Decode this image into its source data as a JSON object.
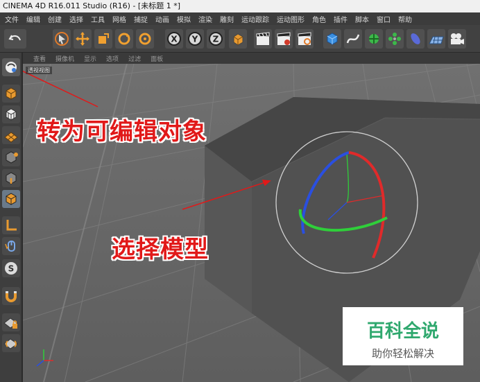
{
  "window": {
    "title": "CINEMA 4D R16.011 Studio (R16) - [未标题 1 *]"
  },
  "menubar": {
    "items": [
      "文件",
      "编辑",
      "创建",
      "选择",
      "工具",
      "网格",
      "捕捉",
      "动画",
      "模拟",
      "渲染",
      "雕刻",
      "运动跟踪",
      "运动图形",
      "角色",
      "插件",
      "脚本",
      "窗口",
      "帮助"
    ]
  },
  "toolbar": {
    "icons": [
      "undo-icon",
      "pointer-icon",
      "move-icon",
      "scale-icon",
      "rotate-icon",
      "recent-tool-icon",
      "x-axis-icon",
      "y-axis-icon",
      "z-axis-icon",
      "coordinate-icon",
      "render-view-icon",
      "render-picture-viewer-icon",
      "render-settings-icon",
      "cube-icon",
      "spline-icon",
      "nurbs-icon",
      "array-icon",
      "deformer-icon",
      "floor-icon",
      "camera-icon"
    ],
    "axis_labels": [
      "X",
      "Y",
      "Z"
    ]
  },
  "sidebar": {
    "icons": [
      "make-editable-icon",
      "model-mode-icon",
      "texture-mode-icon",
      "workplane-icon",
      "points-mode-icon",
      "edges-mode-icon",
      "polygons-mode-icon",
      "axis-mode-icon",
      "tweak-mode-icon",
      "solo-icon",
      "snap-icon",
      "magnet-icon",
      "lock-workplane-icon",
      "grid-snap-icon"
    ]
  },
  "viewport": {
    "menu": [
      "查看",
      "摄像机",
      "显示",
      "选项",
      "过滤",
      "面板"
    ],
    "label": "透视视图"
  },
  "annotations": {
    "make_editable": "转为可编辑对象",
    "select_model": "选择模型"
  },
  "watermark": {
    "title": "百科全说",
    "subtitle": "助你轻松解决"
  },
  "colors": {
    "annotation": "#e11919",
    "watermark": "#2fa86e",
    "axis_x": "#e02a2a",
    "axis_y": "#2fcf3a",
    "axis_z": "#2a4fe0"
  }
}
